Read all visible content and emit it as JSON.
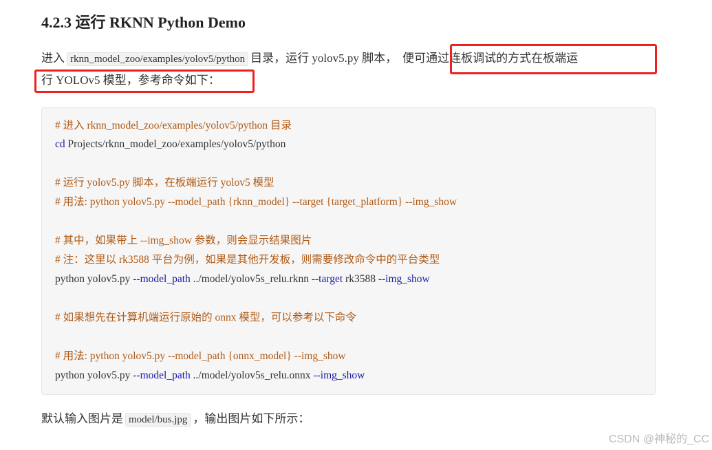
{
  "heading": "4.2.3 运行 RKNN Python Demo",
  "intro": {
    "line1_prefix": "进入",
    "line1_code": "rknn_model_zoo/examples/yolov5/python",
    "line1_middle": "目录，运行 yolov5.py 脚本，",
    "line1_highlight": "便可通过连板调试的方式在板端运",
    "line2_highlight": "行 YOLOv5 模型，参考命令如下："
  },
  "code": {
    "l1_comment": "# 进入 rknn_model_zoo/examples/yolov5/python 目录",
    "l2_cmd": "cd",
    "l2_arg": " Projects/rknn_model_zoo/examples/yolov5/python",
    "l3_comment": "# 运行 yolov5.py 脚本，在板端运行 yolov5 模型",
    "l4_comment": "# 用法: python yolov5.py --model_path {rknn_model} --target {target_platform} --img_show",
    "l5_comment": "# 其中，如果带上 --img_show 参数，则会显示结果图片",
    "l6_comment": "# 注：这里以 rk3588 平台为例，如果是其他开发板，则需要修改命令中的平台类型",
    "l7_a": "python yolov5.py ",
    "l7_b": "--model_path",
    "l7_c": " ../model/yolov5s_relu.rknn ",
    "l7_d": "--target",
    "l7_e": " rk3588 ",
    "l7_f": "--img_show",
    "l8_comment": "# 如果想先在计算机端运行原始的 onnx 模型，可以参考以下命令",
    "l9_comment": "# 用法: python yolov5.py --model_path {onnx_model} --img_show",
    "l10_a": "python yolov5.py ",
    "l10_b": "--model_path",
    "l10_c": " ../model/yolov5s_relu.onnx ",
    "l10_d": "--img_show"
  },
  "footer": {
    "prefix": "默认输入图片是",
    "code": "model/bus.jpg",
    "suffix": "，输出图片如下所示："
  },
  "watermark": "CSDN @神秘的_CC",
  "colors": {
    "highlight_border": "#ee2020",
    "comment": "#b05a14",
    "keyword": "#1a1aa6",
    "code_bg": "#f6f6f6"
  }
}
